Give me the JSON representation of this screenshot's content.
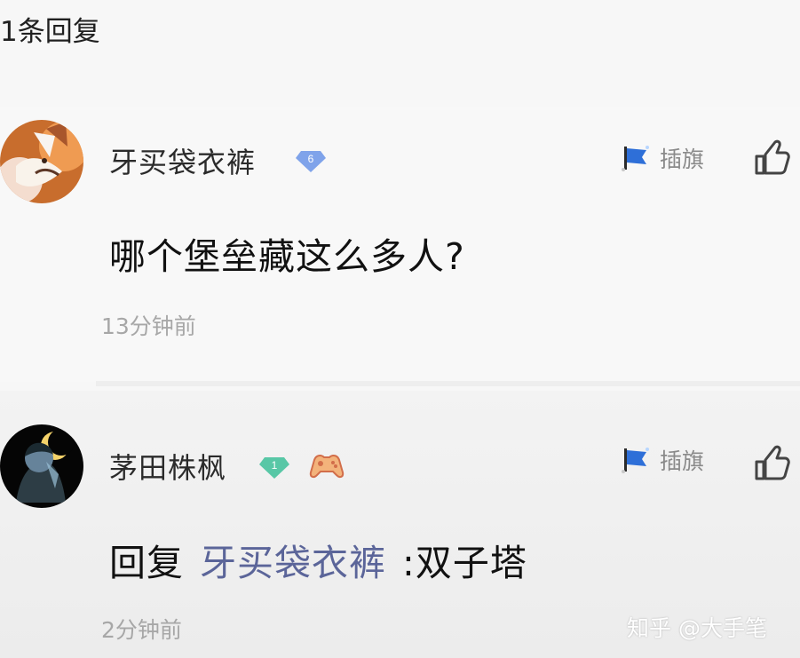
{
  "header": {
    "reply_count_label": "1条回复"
  },
  "comments": [
    {
      "username": "牙买袋衣裤",
      "badge_level": "6",
      "flag_label": "插旗",
      "text": "哪个堡垒藏这么多人?",
      "timestamp": "13分钟前",
      "avatar": "corgi-avatar",
      "badge_color": "#7fa3ea"
    },
    {
      "username": "茅田株枫",
      "badge_level": "1",
      "flag_label": "插旗",
      "reply_prefix": "回复",
      "reply_mention": "牙买袋衣裤",
      "reply_body": ":双子塔",
      "timestamp": "2分钟前",
      "avatar": "moon-avatar",
      "badge_color": "#58c7a6",
      "extra_badge": "gamepad-icon"
    }
  ],
  "watermark": "知乎 @大手笔",
  "colors": {
    "mention": "#5b6599",
    "timestamp": "#a7a7a7",
    "flag_blue": "#2e6fd8"
  }
}
